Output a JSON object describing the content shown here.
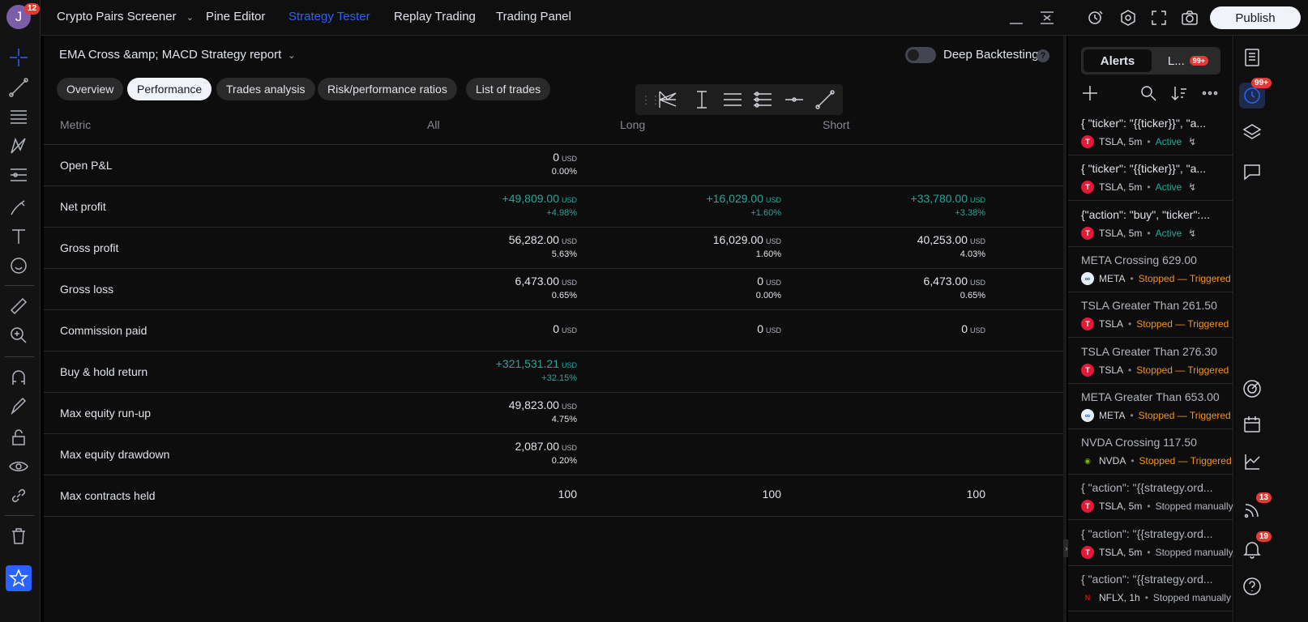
{
  "user": {
    "avatar_letter": "J",
    "notification_count": "12"
  },
  "topbar": {
    "tabs": [
      {
        "label": "Crypto Pairs Screener",
        "dropdown": true
      },
      {
        "label": "Pine Editor"
      },
      {
        "label": "Strategy Tester",
        "active": true
      },
      {
        "label": "Replay Trading"
      },
      {
        "label": "Trading Panel"
      }
    ],
    "publish_label": "Publish"
  },
  "report": {
    "title": "EMA Cross &amp; MACD Strategy report",
    "deep_backtesting_label": "Deep Backtesting",
    "deep_backtesting_enabled": false,
    "help": "?",
    "subtabs": [
      "Overview",
      "Performance",
      "Trades analysis",
      "Risk/performance ratios",
      "List of trades"
    ],
    "active_subtab": "Performance"
  },
  "table": {
    "headers": {
      "metric": "Metric",
      "all": "All",
      "long": "Long",
      "short": "Short"
    },
    "currency": "USD",
    "rows": [
      {
        "label": "Open P&L",
        "all": {
          "val": "0",
          "pct": "0.00%"
        }
      },
      {
        "label": "Net profit",
        "all": {
          "val": "+49,809.00",
          "pct": "+4.98%",
          "pos": true
        },
        "long": {
          "val": "+16,029.00",
          "pct": "+1.60%",
          "pos": true
        },
        "short": {
          "val": "+33,780.00",
          "pct": "+3.38%",
          "pos": true
        }
      },
      {
        "label": "Gross profit",
        "all": {
          "val": "56,282.00",
          "pct": "5.63%"
        },
        "long": {
          "val": "16,029.00",
          "pct": "1.60%"
        },
        "short": {
          "val": "40,253.00",
          "pct": "4.03%"
        }
      },
      {
        "label": "Gross loss",
        "all": {
          "val": "6,473.00",
          "pct": "0.65%"
        },
        "long": {
          "val": "0",
          "pct": "0.00%"
        },
        "short": {
          "val": "6,473.00",
          "pct": "0.65%"
        }
      },
      {
        "label": "Commission paid",
        "all": {
          "val": "0"
        },
        "long": {
          "val": "0"
        },
        "short": {
          "val": "0"
        }
      },
      {
        "label": "Buy & hold return",
        "all": {
          "val": "+321,531.21",
          "pct": "+32.15%",
          "pos": true
        }
      },
      {
        "label": "Max equity run-up",
        "all": {
          "val": "49,823.00",
          "pct": "4.75%"
        }
      },
      {
        "label": "Max equity drawdown",
        "all": {
          "val": "2,087.00",
          "pct": "0.20%"
        }
      },
      {
        "label": "Max contracts held",
        "all": {
          "val": "100",
          "nocur": true
        },
        "long": {
          "val": "100",
          "nocur": true
        },
        "short": {
          "val": "100",
          "nocur": true
        }
      }
    ]
  },
  "alerts_panel": {
    "tab_alerts": "Alerts",
    "tab_log": "L...",
    "log_badge": "99+",
    "items": [
      {
        "title": "{ \"ticker\": \"{{ticker}}\", \"a...",
        "symbol": "TSLA, 5m",
        "logo": "tsla",
        "status": "Active",
        "status_type": "active",
        "trigger_icon": true
      },
      {
        "title": "{ \"ticker\": \"{{ticker}}\", \"a...",
        "symbol": "TSLA, 5m",
        "logo": "tsla",
        "status": "Active",
        "status_type": "active",
        "trigger_icon": true
      },
      {
        "title": "{\"action\": \"buy\", \"ticker\":...",
        "symbol": "TSLA, 5m",
        "logo": "tsla",
        "status": "Active",
        "status_type": "active",
        "trigger_icon": true
      },
      {
        "title": "META Crossing 629.00",
        "symbol": "META",
        "logo": "meta",
        "status": "Stopped — Triggered",
        "status_type": "stopped"
      },
      {
        "title": "TSLA Greater Than 261.50",
        "symbol": "TSLA",
        "logo": "tsla",
        "status": "Stopped — Triggered",
        "status_type": "stopped"
      },
      {
        "title": "TSLA Greater Than 276.30",
        "symbol": "TSLA",
        "logo": "tsla",
        "status": "Stopped — Triggered",
        "status_type": "stopped"
      },
      {
        "title": "META Greater Than 653.00",
        "symbol": "META",
        "logo": "meta",
        "status": "Stopped — Triggered",
        "status_type": "stopped"
      },
      {
        "title": "NVDA Crossing 117.50",
        "symbol": "NVDA",
        "logo": "nvda",
        "status": "Stopped — Triggered",
        "status_type": "stopped"
      },
      {
        "title": "{ \"action\": \"{{strategy.ord...",
        "symbol": "TSLA, 5m",
        "logo": "tsla",
        "status": "Stopped manually",
        "status_type": "manual"
      },
      {
        "title": "{ \"action\": \"{{strategy.ord...",
        "symbol": "TSLA, 5m",
        "logo": "tsla",
        "status": "Stopped manually",
        "status_type": "manual"
      },
      {
        "title": "{ \"action\": \"{{strategy.ord...",
        "symbol": "NFLX, 1h",
        "logo": "nflx",
        "status": "Stopped manually",
        "status_type": "manual"
      }
    ]
  },
  "right_toolbar": {
    "alerts_badge": "99+",
    "signals_badge": "13",
    "notifications_badge": "19"
  }
}
